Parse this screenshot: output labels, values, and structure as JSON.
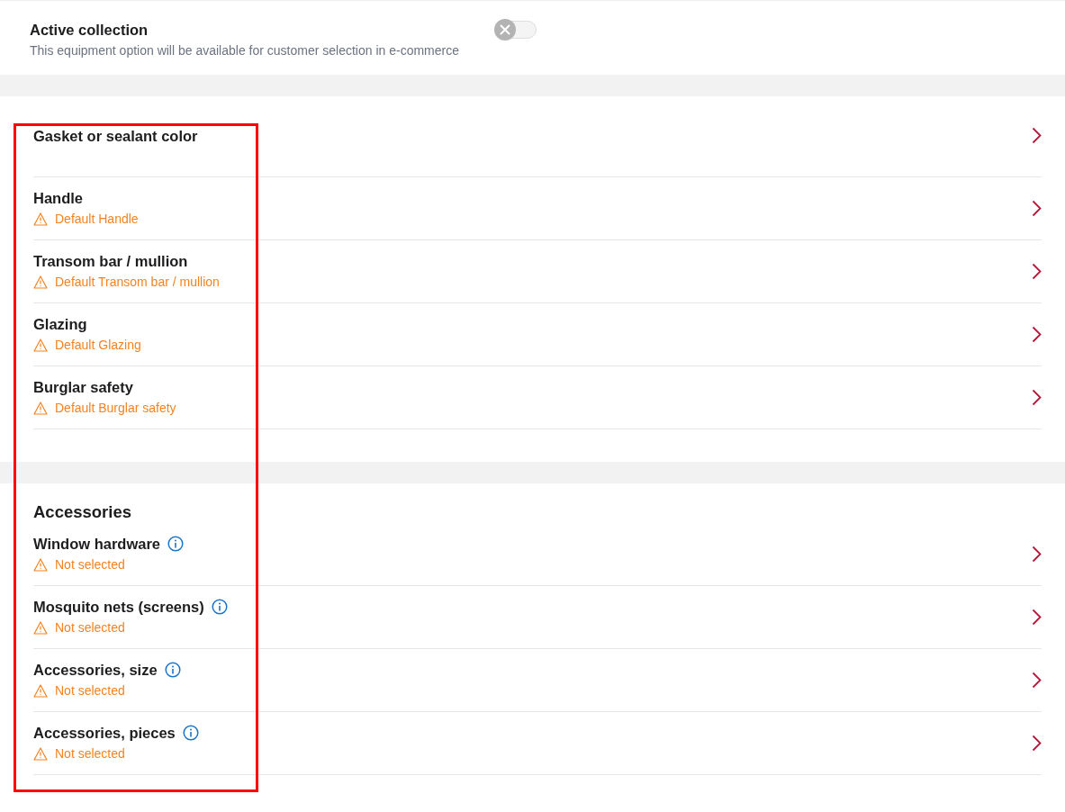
{
  "active_collection": {
    "title": "Active collection",
    "description": "This equipment option will be available for customer selection in e-commerce",
    "on": false
  },
  "options": {
    "items": [
      {
        "title": "Gasket or sealant color",
        "info": false
      },
      {
        "title": "Handle",
        "warning": "Default Handle",
        "info": false
      },
      {
        "title": "Transom bar / mullion",
        "warning": "Default Transom bar / mullion",
        "info": false
      },
      {
        "title": "Glazing",
        "warning": "Default Glazing",
        "info": false
      },
      {
        "title": "Burglar safety",
        "warning": "Default Burglar safety",
        "info": false
      }
    ]
  },
  "accessories": {
    "heading": "Accessories",
    "items": [
      {
        "title": "Window hardware",
        "warning": "Not selected",
        "info": true
      },
      {
        "title": "Mosquito nets (screens)",
        "warning": "Not selected",
        "info": true
      },
      {
        "title": "Accessories, size",
        "warning": "Not selected",
        "info": true
      },
      {
        "title": "Accessories, pieces",
        "warning": "Not selected",
        "info": true
      }
    ]
  },
  "highlight_frame": true
}
